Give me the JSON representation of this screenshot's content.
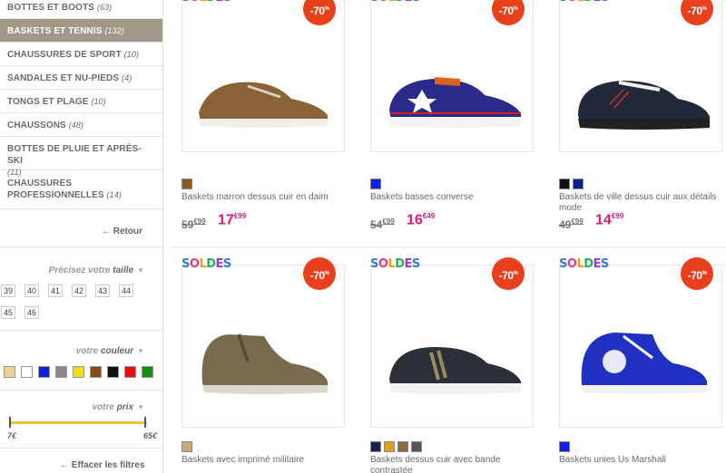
{
  "sidebar": {
    "categories": [
      {
        "label": "BOTTES ET BOOTS",
        "count": "(63)"
      },
      {
        "label": "BASKETS ET TENNIS",
        "count": "(132)"
      },
      {
        "label": "CHAUSSURES DE SPORT",
        "count": "(10)"
      },
      {
        "label": "SANDALES ET NU-PIEDS",
        "count": "(4)"
      },
      {
        "label": "TONGS ET PLAGE",
        "count": "(10)"
      },
      {
        "label": "CHAUSSONS",
        "count": "(48)"
      },
      {
        "label": "BOTTES DE PLUIE ET APRÈS-SKI",
        "count": "(11)"
      },
      {
        "label": "CHAUSSURES PROFESSIONNELLES",
        "count": "(14)"
      }
    ],
    "active_category": "BASKETS ET TENNIS",
    "retour": "← Retour",
    "size_filter": {
      "prefix": "Précisez votre ",
      "key": "taille",
      "sizes": [
        "39",
        "40",
        "41",
        "42",
        "43",
        "44",
        "45",
        "46"
      ]
    },
    "color_filter": {
      "prefix": "votre ",
      "key": "couleur",
      "colors": [
        "#f0d090",
        "#ffffff",
        "#1020e0",
        "#888888",
        "#f0e010",
        "#8a4a18",
        "#111111",
        "#e01010",
        "#109010"
      ]
    },
    "price_filter": {
      "prefix": "votre ",
      "key": "prix",
      "min": "7€",
      "max": "65€"
    },
    "clear_filters": "← Effacer les filtres"
  },
  "products": [
    {
      "name": "Baskets marron dessus cuir en daim",
      "old_int": "59",
      "old_dec": "€99",
      "new_int": "17",
      "new_dec": "€99",
      "discount": "-70",
      "swatches": [
        "#8a5a22"
      ],
      "shoe": "brown"
    },
    {
      "name": "Baskets basses converse",
      "old_int": "54",
      "old_dec": "€99",
      "new_int": "16",
      "new_dec": "€49",
      "discount": "-70",
      "swatches": [
        "#1020e0"
      ],
      "shoe": "blue"
    },
    {
      "name": "Baskets de ville dessus cuir aux détails mode",
      "old_int": "49",
      "old_dec": "€99",
      "new_int": "14",
      "new_dec": "€99",
      "discount": "-70",
      "swatches": [
        "#111111",
        "#10208a"
      ],
      "shoe": "navy"
    },
    {
      "name": "Baskets avec imprimé militaire",
      "old_int": "",
      "old_dec": "",
      "new_int": "",
      "new_dec": "",
      "discount": "-70",
      "swatches": [
        "#c8a878"
      ],
      "shoe": "khaki"
    },
    {
      "name": "Baskets dessus cuir avec bande contrastée",
      "old_int": "",
      "old_dec": "",
      "new_int": "",
      "new_dec": "",
      "discount": "-70",
      "swatches": [
        "#1a2340",
        "#e0a020",
        "#8a6a40",
        "#555555"
      ],
      "shoe": "dark"
    },
    {
      "name": "Baskets unies Us Marshall",
      "old_int": "",
      "old_dec": "",
      "new_int": "",
      "new_dec": "",
      "discount": "-70",
      "swatches": [
        "#1020e0"
      ],
      "shoe": "royal"
    }
  ],
  "soldes_label": "SOLDES",
  "badge_suffix": "%"
}
